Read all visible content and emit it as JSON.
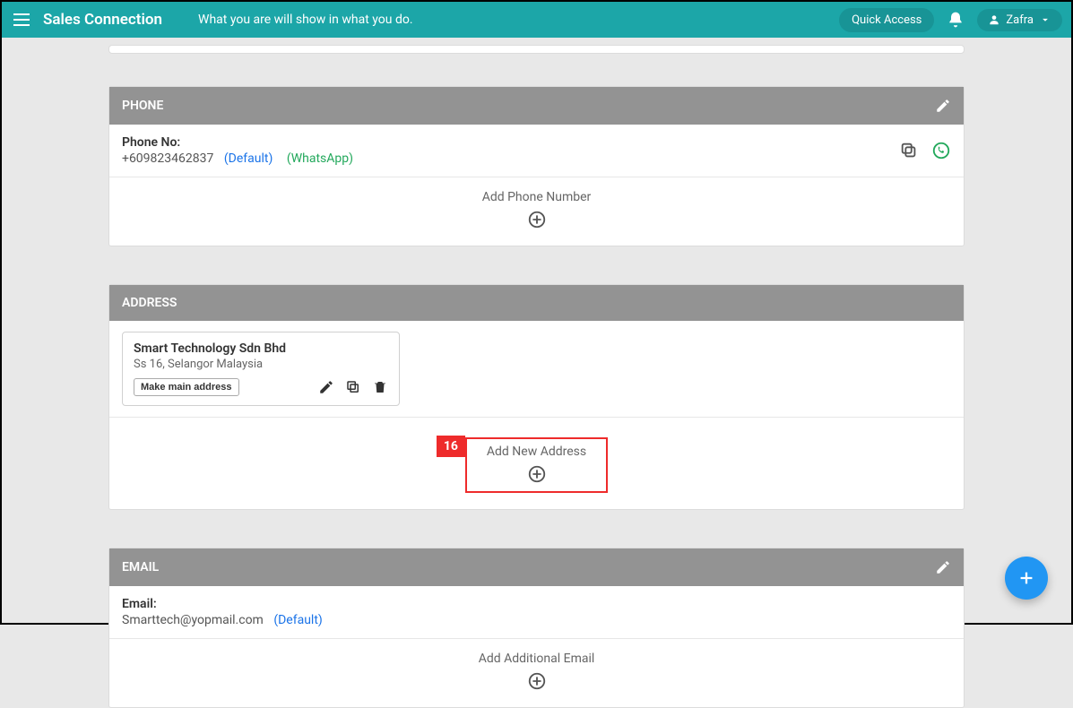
{
  "header": {
    "brand": "Sales Connection",
    "tagline": "What you are will show in what you do.",
    "quick_access_label": "Quick Access",
    "user_name": "Zafra"
  },
  "phone": {
    "section_title": "PHONE",
    "label": "Phone No:",
    "number": "+609823462837",
    "default_tag": "(Default)",
    "whatsapp_tag": "(WhatsApp)",
    "add_label": "Add Phone Number"
  },
  "address": {
    "section_title": "ADDRESS",
    "card": {
      "name": "Smart Technology Sdn Bhd",
      "line": "Ss 16, Selangor Malaysia",
      "make_main_label": "Make main address"
    },
    "add_label": "Add New Address",
    "callout_number": "16"
  },
  "email": {
    "section_title": "EMAIL",
    "label": "Email:",
    "value": "Smarttech@yopmail.com",
    "default_tag": "(Default)",
    "add_label": "Add Additional Email"
  },
  "colors": {
    "primary": "#1ca6a8",
    "danger": "#ee2b2b",
    "link": "#1a73e8",
    "whatsapp": "#22a85b",
    "fab": "#2196f3"
  }
}
